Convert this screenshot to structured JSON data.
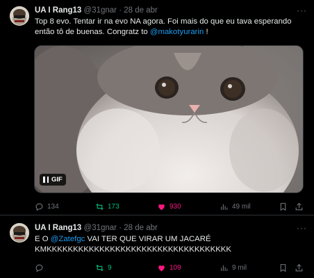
{
  "tweets": [
    {
      "name": "UA I Rang13",
      "handle": "@31gnar",
      "separator": "·",
      "date": "28 de abr",
      "text_pre": "Top 8 evo. Tentar ir na evo NA agora. Foi mais do que eu tava esperando então tô de buenas. Congratz to ",
      "mention": "@makotyurarin",
      "text_post": " !",
      "media": {
        "badge": "GIF"
      },
      "actions": {
        "replies": "134",
        "retweets": "173",
        "likes": "930",
        "views": "49 mil"
      }
    },
    {
      "name": "UA I Rang13",
      "handle": "@31gnar",
      "separator": "·",
      "date": "28 de abr",
      "text_pre": "E O ",
      "mention": "@Zatefgc",
      "text_post": " VAI TER QUE VIRAR UM JACARÉ KMKKKKKKKKKKKKKKKKKKKKKKKKKKKKKKKKKKK",
      "actions": {
        "replies": "",
        "retweets": "9",
        "likes": "109",
        "views": "9 mil"
      }
    }
  ],
  "more_label": "···",
  "colors": {
    "accent": "#1d9bf0",
    "retweet": "#00ba7c",
    "like": "#f91880",
    "muted": "#71767b"
  }
}
